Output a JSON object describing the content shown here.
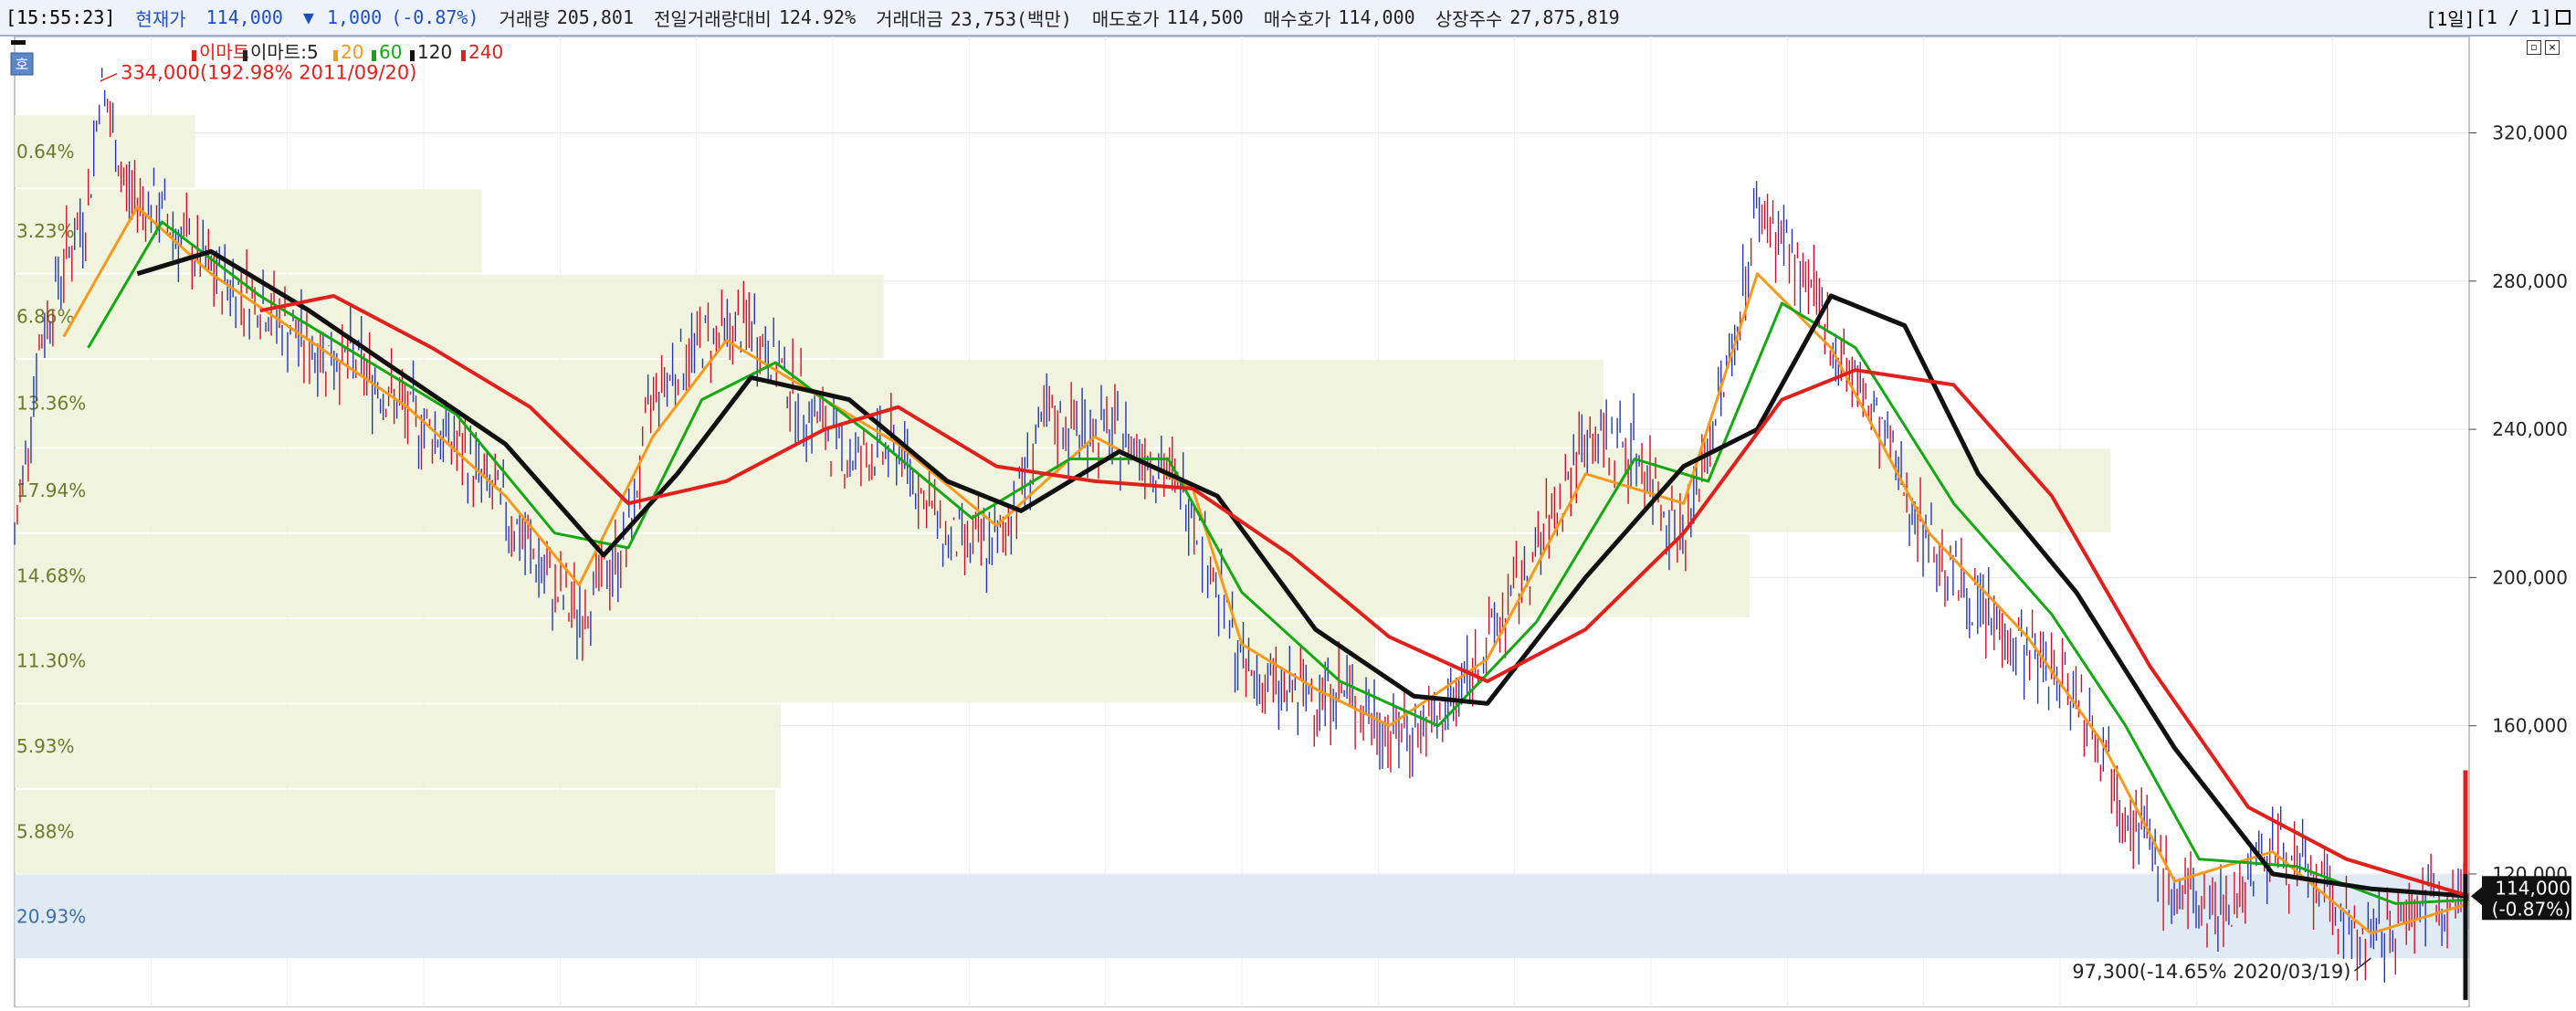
{
  "header": {
    "time": "[15:55:23]",
    "price_label": "현재가",
    "price": "114,000",
    "change_arrow": "▼",
    "change": "1,000",
    "change_pct": "(-0.87%)",
    "volume_label": "거래량",
    "volume": "205,801",
    "prev_vol_label": "전일거래량대비",
    "prev_vol": "124.92%",
    "amount_label": "거래대금",
    "amount": "23,753(백만)",
    "ask_label": "매도호가",
    "ask": "114,500",
    "bid_label": "매수호가",
    "bid": "114,000",
    "shares_label": "상장주수",
    "shares": "27,875,819",
    "period": "[1일]",
    "pages": "[1 / 1]"
  },
  "legend": {
    "mode_button": "호",
    "items": [
      {
        "text": "이마트",
        "color": "#e0201c"
      },
      {
        "text": "이마트:5",
        "color": "#222222"
      },
      {
        "text": "20",
        "color": "#f59a1a"
      },
      {
        "text": "60",
        "color": "#14a814"
      },
      {
        "text": "120",
        "color": "#111111"
      },
      {
        "text": "240",
        "color": "#e0201c"
      }
    ]
  },
  "annotations": {
    "high": "334,000(192.98% 2011/09/20)",
    "low": "97,300(-14.65% 2020/03/19)"
  },
  "price_tag": {
    "price": "114,000",
    "pct": "(-0.87%)"
  },
  "chart_data": {
    "type": "line",
    "title": "이마트",
    "y_axis": {
      "ticks": [
        "120,000",
        "160,000",
        "200,000",
        "240,000",
        "280,000",
        "320,000"
      ],
      "tick_values": [
        120000,
        160000,
        200000,
        240000,
        280000,
        320000
      ],
      "ylim": [
        84000,
        346000
      ],
      "position": "right"
    },
    "x_range": [
      "2011/05",
      "2020/06"
    ],
    "grid": true,
    "volume_profile": [
      {
        "label": "0.64%",
        "from": 305000,
        "to": 325000,
        "share": 0.64
      },
      {
        "label": "3.23%",
        "from": 282000,
        "to": 305000,
        "share": 3.23
      },
      {
        "label": "6.86%",
        "from": 259000,
        "to": 282000,
        "share": 6.86
      },
      {
        "label": "13.36%",
        "from": 235000,
        "to": 259000,
        "share": 13.36
      },
      {
        "label": "17.94%",
        "from": 212000,
        "to": 235000,
        "share": 17.94
      },
      {
        "label": "14.68%",
        "from": 189000,
        "to": 212000,
        "share": 14.68
      },
      {
        "label": "11.30%",
        "from": 166000,
        "to": 189000,
        "share": 11.3
      },
      {
        "label": "5.93%",
        "from": 143000,
        "to": 166000,
        "share": 5.93
      },
      {
        "label": "5.88%",
        "from": 120000,
        "to": 143000,
        "share": 5.88
      },
      {
        "label": "20.93%",
        "from": 97000,
        "to": 120000,
        "share": 20.93
      }
    ],
    "series": [
      {
        "name": "이마트",
        "kind": "price",
        "color": "#c0102c",
        "points": [
          [
            0,
            210000
          ],
          [
            0.01,
            262000
          ],
          [
            0.02,
            285000
          ],
          [
            0.03,
            300000
          ],
          [
            0.035,
            334000
          ],
          [
            0.045,
            305000
          ],
          [
            0.06,
            298000
          ],
          [
            0.08,
            282000
          ],
          [
            0.1,
            275000
          ],
          [
            0.12,
            262000
          ],
          [
            0.14,
            258000
          ],
          [
            0.16,
            244000
          ],
          [
            0.18,
            236000
          ],
          [
            0.2,
            218000
          ],
          [
            0.22,
            196000
          ],
          [
            0.23,
            190000
          ],
          [
            0.25,
            210000
          ],
          [
            0.26,
            250000
          ],
          [
            0.28,
            264000
          ],
          [
            0.3,
            268000
          ],
          [
            0.32,
            248000
          ],
          [
            0.34,
            232000
          ],
          [
            0.36,
            235000
          ],
          [
            0.38,
            210000
          ],
          [
            0.4,
            208000
          ],
          [
            0.42,
            242000
          ],
          [
            0.44,
            240000
          ],
          [
            0.46,
            235000
          ],
          [
            0.48,
            220000
          ],
          [
            0.5,
            175000
          ],
          [
            0.52,
            168000
          ],
          [
            0.54,
            170000
          ],
          [
            0.56,
            158000
          ],
          [
            0.58,
            160000
          ],
          [
            0.6,
            182000
          ],
          [
            0.62,
            206000
          ],
          [
            0.64,
            238000
          ],
          [
            0.66,
            235000
          ],
          [
            0.68,
            210000
          ],
          [
            0.7,
            262000
          ],
          [
            0.71,
            300000
          ],
          [
            0.72,
            292000
          ],
          [
            0.74,
            265000
          ],
          [
            0.76,
            240000
          ],
          [
            0.78,
            210000
          ],
          [
            0.8,
            192000
          ],
          [
            0.82,
            180000
          ],
          [
            0.84,
            170000
          ],
          [
            0.86,
            140000
          ],
          [
            0.88,
            114000
          ],
          [
            0.9,
            110000
          ],
          [
            0.92,
            128000
          ],
          [
            0.94,
            115000
          ],
          [
            0.96,
            100000
          ],
          [
            0.98,
            113000
          ],
          [
            1.0,
            114000
          ]
        ]
      },
      {
        "name": "20",
        "kind": "ma",
        "color": "#f59a1a",
        "points": [
          [
            0.02,
            265000
          ],
          [
            0.05,
            300000
          ],
          [
            0.08,
            282000
          ],
          [
            0.12,
            264000
          ],
          [
            0.16,
            246000
          ],
          [
            0.2,
            222000
          ],
          [
            0.23,
            198000
          ],
          [
            0.26,
            238000
          ],
          [
            0.29,
            264000
          ],
          [
            0.32,
            252000
          ],
          [
            0.36,
            236000
          ],
          [
            0.4,
            214000
          ],
          [
            0.44,
            238000
          ],
          [
            0.48,
            224000
          ],
          [
            0.5,
            182000
          ],
          [
            0.53,
            170000
          ],
          [
            0.56,
            160000
          ],
          [
            0.6,
            178000
          ],
          [
            0.64,
            228000
          ],
          [
            0.68,
            220000
          ],
          [
            0.71,
            282000
          ],
          [
            0.74,
            262000
          ],
          [
            0.78,
            212000
          ],
          [
            0.82,
            184000
          ],
          [
            0.85,
            156000
          ],
          [
            0.88,
            118000
          ],
          [
            0.92,
            126000
          ],
          [
            0.96,
            104000
          ],
          [
            1.0,
            112000
          ]
        ]
      },
      {
        "name": "60",
        "kind": "ma",
        "color": "#14a814",
        "points": [
          [
            0.03,
            262000
          ],
          [
            0.06,
            296000
          ],
          [
            0.1,
            276000
          ],
          [
            0.14,
            260000
          ],
          [
            0.18,
            244000
          ],
          [
            0.22,
            212000
          ],
          [
            0.25,
            208000
          ],
          [
            0.28,
            248000
          ],
          [
            0.31,
            258000
          ],
          [
            0.35,
            238000
          ],
          [
            0.39,
            216000
          ],
          [
            0.43,
            232000
          ],
          [
            0.47,
            232000
          ],
          [
            0.5,
            196000
          ],
          [
            0.54,
            172000
          ],
          [
            0.58,
            160000
          ],
          [
            0.62,
            188000
          ],
          [
            0.66,
            232000
          ],
          [
            0.69,
            226000
          ],
          [
            0.72,
            274000
          ],
          [
            0.75,
            262000
          ],
          [
            0.79,
            220000
          ],
          [
            0.83,
            190000
          ],
          [
            0.86,
            160000
          ],
          [
            0.89,
            124000
          ],
          [
            0.93,
            122000
          ],
          [
            0.97,
            112000
          ],
          [
            1.0,
            113000
          ]
        ]
      },
      {
        "name": "120",
        "kind": "ma",
        "color": "#111111",
        "points": [
          [
            0.05,
            282000
          ],
          [
            0.08,
            288000
          ],
          [
            0.12,
            272000
          ],
          [
            0.16,
            254000
          ],
          [
            0.2,
            236000
          ],
          [
            0.24,
            206000
          ],
          [
            0.27,
            228000
          ],
          [
            0.3,
            254000
          ],
          [
            0.34,
            248000
          ],
          [
            0.38,
            226000
          ],
          [
            0.41,
            218000
          ],
          [
            0.45,
            234000
          ],
          [
            0.49,
            222000
          ],
          [
            0.53,
            186000
          ],
          [
            0.57,
            168000
          ],
          [
            0.6,
            166000
          ],
          [
            0.64,
            200000
          ],
          [
            0.68,
            230000
          ],
          [
            0.71,
            240000
          ],
          [
            0.74,
            276000
          ],
          [
            0.77,
            268000
          ],
          [
            0.8,
            228000
          ],
          [
            0.84,
            196000
          ],
          [
            0.88,
            154000
          ],
          [
            0.92,
            120000
          ],
          [
            0.96,
            116000
          ],
          [
            1.0,
            114000
          ]
        ]
      },
      {
        "name": "240",
        "kind": "ma",
        "color": "#e0201c",
        "points": [
          [
            0.1,
            272000
          ],
          [
            0.13,
            276000
          ],
          [
            0.17,
            262000
          ],
          [
            0.21,
            246000
          ],
          [
            0.25,
            220000
          ],
          [
            0.29,
            226000
          ],
          [
            0.33,
            240000
          ],
          [
            0.36,
            246000
          ],
          [
            0.4,
            230000
          ],
          [
            0.44,
            226000
          ],
          [
            0.48,
            224000
          ],
          [
            0.52,
            206000
          ],
          [
            0.56,
            184000
          ],
          [
            0.6,
            172000
          ],
          [
            0.64,
            186000
          ],
          [
            0.68,
            212000
          ],
          [
            0.72,
            248000
          ],
          [
            0.75,
            256000
          ],
          [
            0.79,
            252000
          ],
          [
            0.83,
            222000
          ],
          [
            0.87,
            176000
          ],
          [
            0.91,
            138000
          ],
          [
            0.95,
            124000
          ],
          [
            1.0,
            114000
          ]
        ]
      }
    ]
  }
}
